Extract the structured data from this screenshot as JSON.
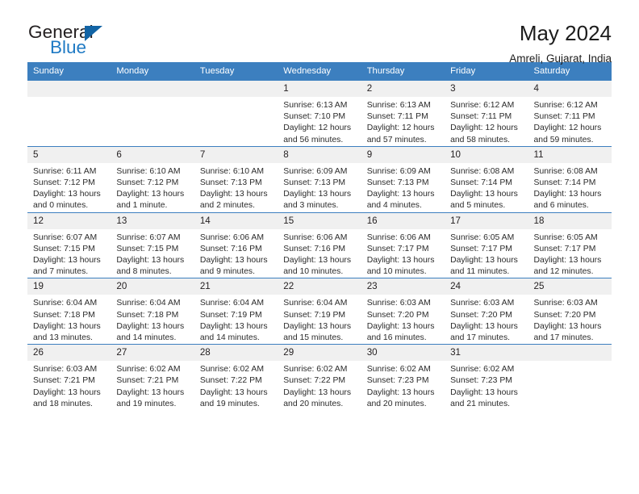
{
  "brand": {
    "name_part1": "General",
    "name_part2": "Blue",
    "triangle_icon": "triangle-icon",
    "accent_color": "#1f7ac4",
    "header_color": "#3c7fbf"
  },
  "header": {
    "title": "May 2024",
    "subtitle": "Amreli, Gujarat, India"
  },
  "calendar": {
    "weekday_headers": [
      "Sunday",
      "Monday",
      "Tuesday",
      "Wednesday",
      "Thursday",
      "Friday",
      "Saturday"
    ],
    "weeks": [
      [
        {
          "day": "",
          "lines": []
        },
        {
          "day": "",
          "lines": []
        },
        {
          "day": "",
          "lines": []
        },
        {
          "day": "1",
          "lines": [
            "Sunrise: 6:13 AM",
            "Sunset: 7:10 PM",
            "Daylight: 12 hours and 56 minutes."
          ]
        },
        {
          "day": "2",
          "lines": [
            "Sunrise: 6:13 AM",
            "Sunset: 7:11 PM",
            "Daylight: 12 hours and 57 minutes."
          ]
        },
        {
          "day": "3",
          "lines": [
            "Sunrise: 6:12 AM",
            "Sunset: 7:11 PM",
            "Daylight: 12 hours and 58 minutes."
          ]
        },
        {
          "day": "4",
          "lines": [
            "Sunrise: 6:12 AM",
            "Sunset: 7:11 PM",
            "Daylight: 12 hours and 59 minutes."
          ]
        }
      ],
      [
        {
          "day": "5",
          "lines": [
            "Sunrise: 6:11 AM",
            "Sunset: 7:12 PM",
            "Daylight: 13 hours and 0 minutes."
          ]
        },
        {
          "day": "6",
          "lines": [
            "Sunrise: 6:10 AM",
            "Sunset: 7:12 PM",
            "Daylight: 13 hours and 1 minute."
          ]
        },
        {
          "day": "7",
          "lines": [
            "Sunrise: 6:10 AM",
            "Sunset: 7:13 PM",
            "Daylight: 13 hours and 2 minutes."
          ]
        },
        {
          "day": "8",
          "lines": [
            "Sunrise: 6:09 AM",
            "Sunset: 7:13 PM",
            "Daylight: 13 hours and 3 minutes."
          ]
        },
        {
          "day": "9",
          "lines": [
            "Sunrise: 6:09 AM",
            "Sunset: 7:13 PM",
            "Daylight: 13 hours and 4 minutes."
          ]
        },
        {
          "day": "10",
          "lines": [
            "Sunrise: 6:08 AM",
            "Sunset: 7:14 PM",
            "Daylight: 13 hours and 5 minutes."
          ]
        },
        {
          "day": "11",
          "lines": [
            "Sunrise: 6:08 AM",
            "Sunset: 7:14 PM",
            "Daylight: 13 hours and 6 minutes."
          ]
        }
      ],
      [
        {
          "day": "12",
          "lines": [
            "Sunrise: 6:07 AM",
            "Sunset: 7:15 PM",
            "Daylight: 13 hours and 7 minutes."
          ]
        },
        {
          "day": "13",
          "lines": [
            "Sunrise: 6:07 AM",
            "Sunset: 7:15 PM",
            "Daylight: 13 hours and 8 minutes."
          ]
        },
        {
          "day": "14",
          "lines": [
            "Sunrise: 6:06 AM",
            "Sunset: 7:16 PM",
            "Daylight: 13 hours and 9 minutes."
          ]
        },
        {
          "day": "15",
          "lines": [
            "Sunrise: 6:06 AM",
            "Sunset: 7:16 PM",
            "Daylight: 13 hours and 10 minutes."
          ]
        },
        {
          "day": "16",
          "lines": [
            "Sunrise: 6:06 AM",
            "Sunset: 7:17 PM",
            "Daylight: 13 hours and 10 minutes."
          ]
        },
        {
          "day": "17",
          "lines": [
            "Sunrise: 6:05 AM",
            "Sunset: 7:17 PM",
            "Daylight: 13 hours and 11 minutes."
          ]
        },
        {
          "day": "18",
          "lines": [
            "Sunrise: 6:05 AM",
            "Sunset: 7:17 PM",
            "Daylight: 13 hours and 12 minutes."
          ]
        }
      ],
      [
        {
          "day": "19",
          "lines": [
            "Sunrise: 6:04 AM",
            "Sunset: 7:18 PM",
            "Daylight: 13 hours and 13 minutes."
          ]
        },
        {
          "day": "20",
          "lines": [
            "Sunrise: 6:04 AM",
            "Sunset: 7:18 PM",
            "Daylight: 13 hours and 14 minutes."
          ]
        },
        {
          "day": "21",
          "lines": [
            "Sunrise: 6:04 AM",
            "Sunset: 7:19 PM",
            "Daylight: 13 hours and 14 minutes."
          ]
        },
        {
          "day": "22",
          "lines": [
            "Sunrise: 6:04 AM",
            "Sunset: 7:19 PM",
            "Daylight: 13 hours and 15 minutes."
          ]
        },
        {
          "day": "23",
          "lines": [
            "Sunrise: 6:03 AM",
            "Sunset: 7:20 PM",
            "Daylight: 13 hours and 16 minutes."
          ]
        },
        {
          "day": "24",
          "lines": [
            "Sunrise: 6:03 AM",
            "Sunset: 7:20 PM",
            "Daylight: 13 hours and 17 minutes."
          ]
        },
        {
          "day": "25",
          "lines": [
            "Sunrise: 6:03 AM",
            "Sunset: 7:20 PM",
            "Daylight: 13 hours and 17 minutes."
          ]
        }
      ],
      [
        {
          "day": "26",
          "lines": [
            "Sunrise: 6:03 AM",
            "Sunset: 7:21 PM",
            "Daylight: 13 hours and 18 minutes."
          ]
        },
        {
          "day": "27",
          "lines": [
            "Sunrise: 6:02 AM",
            "Sunset: 7:21 PM",
            "Daylight: 13 hours and 19 minutes."
          ]
        },
        {
          "day": "28",
          "lines": [
            "Sunrise: 6:02 AM",
            "Sunset: 7:22 PM",
            "Daylight: 13 hours and 19 minutes."
          ]
        },
        {
          "day": "29",
          "lines": [
            "Sunrise: 6:02 AM",
            "Sunset: 7:22 PM",
            "Daylight: 13 hours and 20 minutes."
          ]
        },
        {
          "day": "30",
          "lines": [
            "Sunrise: 6:02 AM",
            "Sunset: 7:23 PM",
            "Daylight: 13 hours and 20 minutes."
          ]
        },
        {
          "day": "31",
          "lines": [
            "Sunrise: 6:02 AM",
            "Sunset: 7:23 PM",
            "Daylight: 13 hours and 21 minutes."
          ]
        },
        {
          "day": "",
          "lines": []
        }
      ]
    ]
  }
}
